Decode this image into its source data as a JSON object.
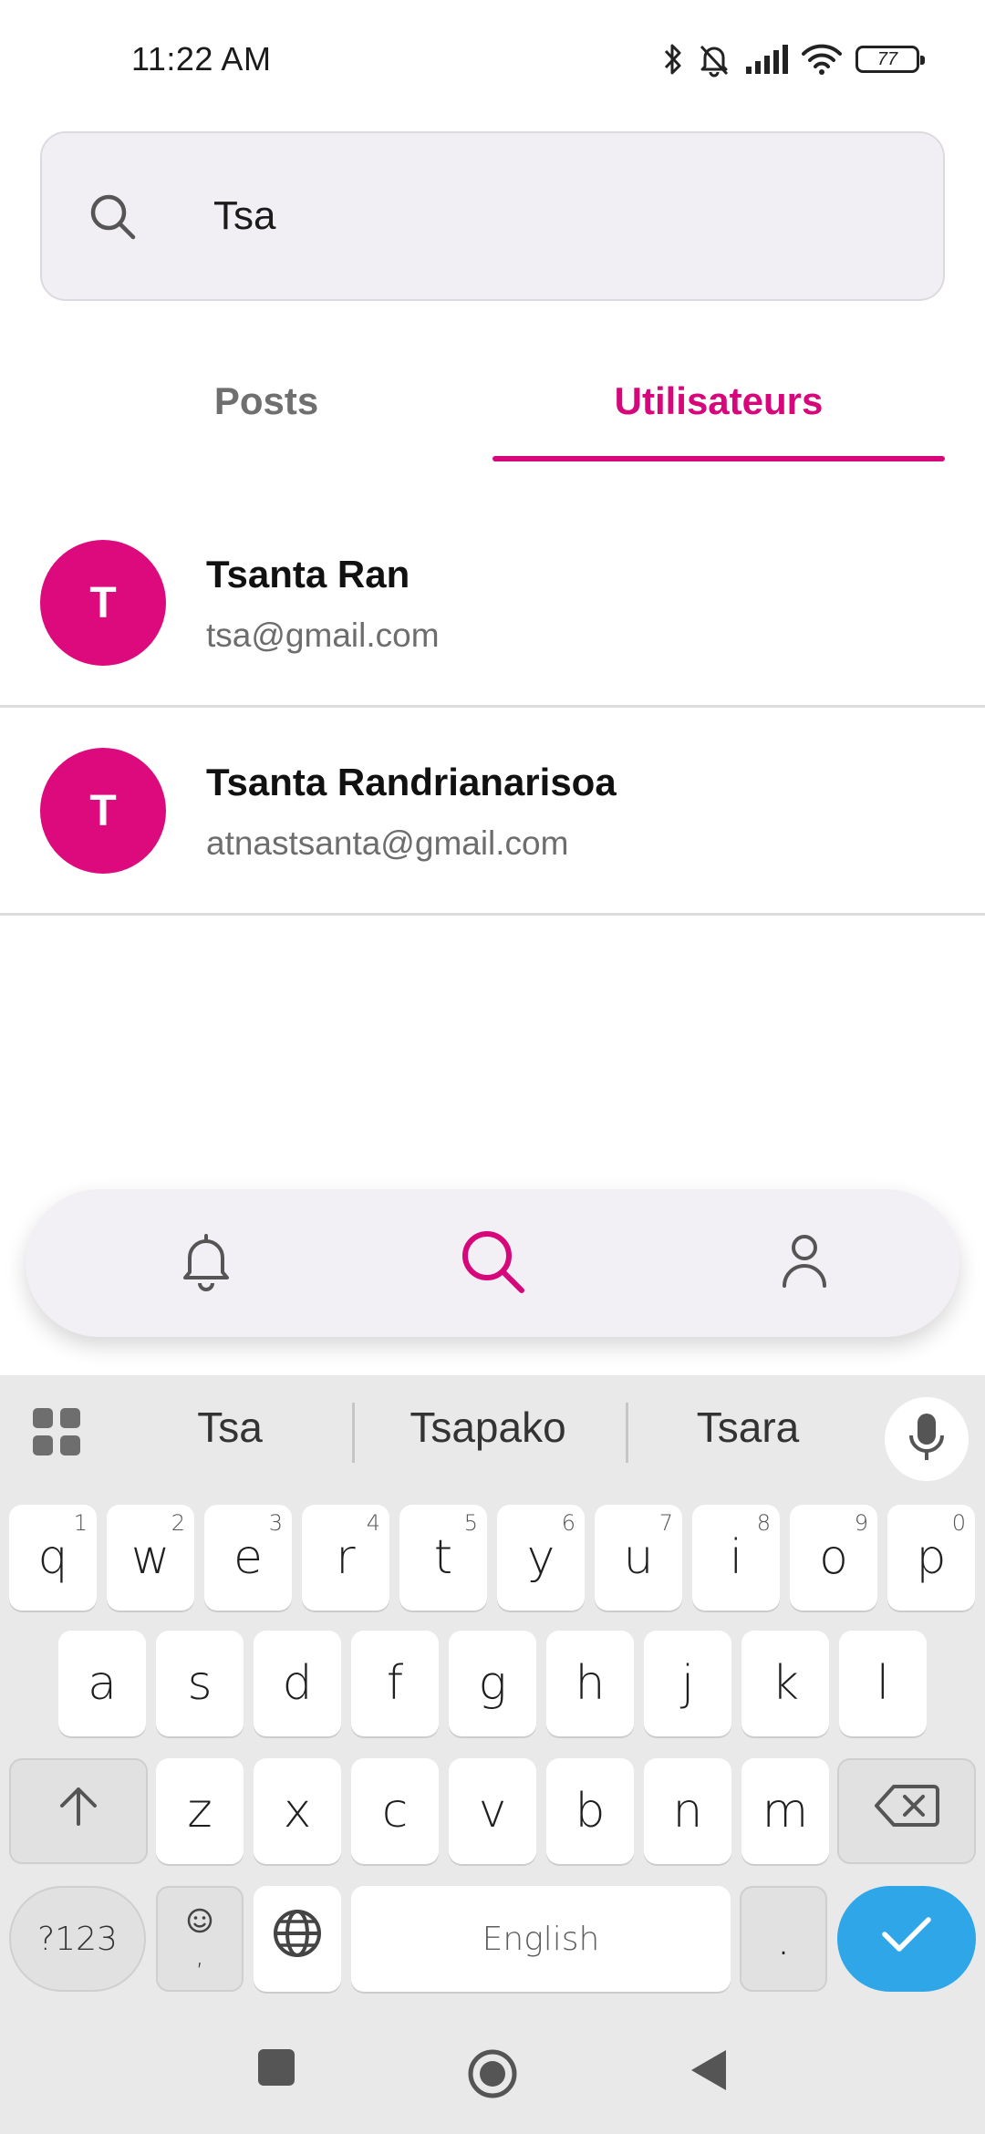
{
  "status_bar": {
    "time": "11:22 AM",
    "battery": "77",
    "icons": [
      "bluetooth-icon",
      "bell-off-icon",
      "signal-icon",
      "wifi-icon",
      "battery-icon"
    ]
  },
  "search": {
    "value": "Tsa",
    "icon": "search-icon"
  },
  "tabs": [
    {
      "label": "Posts",
      "active": false
    },
    {
      "label": "Utilisateurs",
      "active": true
    }
  ],
  "users": [
    {
      "initial": "T",
      "name": "Tsanta Ran",
      "email": "tsa@gmail.com"
    },
    {
      "initial": "T",
      "name": "Tsanta Randrianarisoa",
      "email": "atnastsanta@gmail.com"
    }
  ],
  "bottom_nav": {
    "items": [
      "bell-icon",
      "search-icon",
      "profile-icon"
    ],
    "active": "search-icon"
  },
  "keyboard": {
    "suggestions": [
      "Tsa",
      "Tsapako",
      "Tsara"
    ],
    "row1": [
      {
        "key": "q",
        "hint": "1"
      },
      {
        "key": "w",
        "hint": "2"
      },
      {
        "key": "e",
        "hint": "3"
      },
      {
        "key": "r",
        "hint": "4"
      },
      {
        "key": "t",
        "hint": "5"
      },
      {
        "key": "y",
        "hint": "6"
      },
      {
        "key": "u",
        "hint": "7"
      },
      {
        "key": "i",
        "hint": "8"
      },
      {
        "key": "o",
        "hint": "9"
      },
      {
        "key": "p",
        "hint": "0"
      }
    ],
    "row2": [
      "a",
      "s",
      "d",
      "f",
      "g",
      "h",
      "j",
      "k",
      "l"
    ],
    "row3": [
      "z",
      "x",
      "c",
      "v",
      "b",
      "n",
      "m"
    ],
    "symbols_label": "?123",
    "comma_label": ",",
    "space_label": "English",
    "period_label": "."
  },
  "colors": {
    "accent": "#d6077a",
    "avatar": "#dc0a7c",
    "done_key": "#2ea6e8"
  }
}
